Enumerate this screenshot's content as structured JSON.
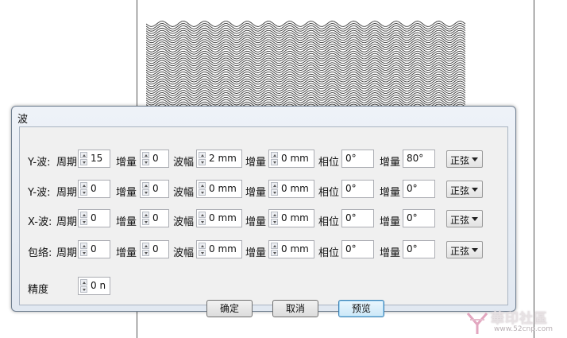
{
  "colors": {
    "dialog_border": "#6f7e90",
    "panel_bg": "#f0f0f0",
    "wave_stroke": "#3a3a3a",
    "focus_border": "#3c7fb1"
  },
  "dialog": {
    "title": "波",
    "rows": [
      {
        "label": "Y-波:",
        "period_label": "周期",
        "period": "15",
        "inc1_label": "增量",
        "inc1": "0",
        "amp_label": "波幅",
        "amp": "2 mm",
        "inc2_label": "增量",
        "inc2": "0 mm",
        "phase_label": "相位",
        "phase": "0°",
        "inc3_label": "增量",
        "inc3": "80°",
        "type": "正弦"
      },
      {
        "label": "Y-波:",
        "period_label": "周期",
        "period": "0",
        "inc1_label": "增量",
        "inc1": "0",
        "amp_label": "波幅",
        "amp": "0 mm",
        "inc2_label": "增量",
        "inc2": "0 mm",
        "phase_label": "相位",
        "phase": "0°",
        "inc3_label": "增量",
        "inc3": "0°",
        "type": "正弦"
      },
      {
        "label": "X-波:",
        "period_label": "周期",
        "period": "0",
        "inc1_label": "增量",
        "inc1": "0",
        "amp_label": "波幅",
        "amp": "0 mm",
        "inc2_label": "增量",
        "inc2": "0 mm",
        "phase_label": "相位",
        "phase": "0°",
        "inc3_label": "增量",
        "inc3": "0°",
        "type": "正弦"
      },
      {
        "label": "包络:",
        "period_label": "周期",
        "period": "0",
        "inc1_label": "增量",
        "inc1": "0",
        "amp_label": "波幅",
        "amp": "0 mm",
        "inc2_label": "增量",
        "inc2": "0 mm",
        "phase_label": "相位",
        "phase": "0°",
        "inc3_label": "增量",
        "inc3": "0°",
        "type": "正弦"
      }
    ],
    "precision_label": "精度",
    "precision": "0 n",
    "buttons": {
      "ok": "确定",
      "cancel": "取消",
      "preview": "预览"
    }
  },
  "watermark": {
    "title": "華印社區",
    "url": "www.52cnp.com"
  }
}
